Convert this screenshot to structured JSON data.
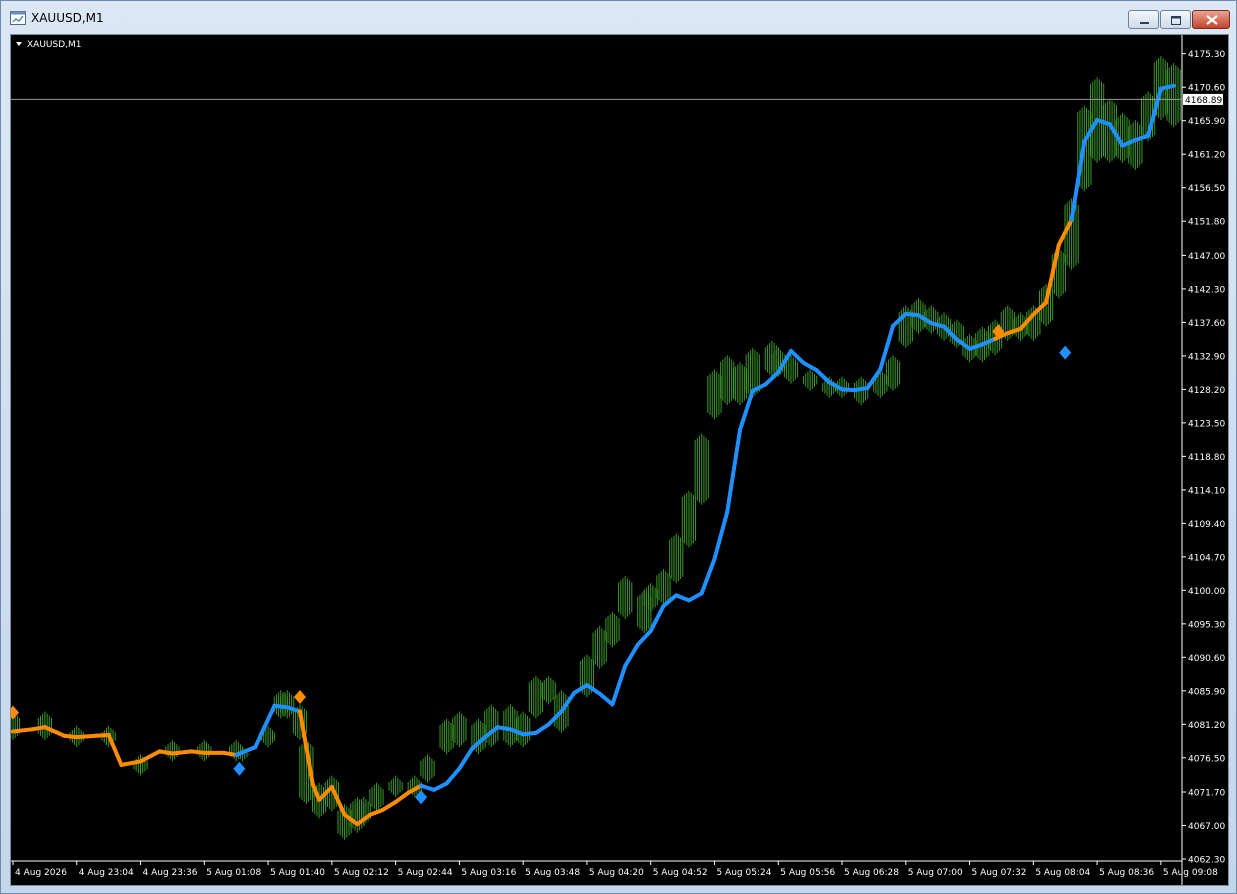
{
  "window": {
    "title": "XAUUSD,M1",
    "buttons": [
      "minimize",
      "maximize",
      "close"
    ]
  },
  "chart_header": {
    "symbol_label": "XAUUSD,M1"
  },
  "colors": {
    "background": "#000000",
    "bars": "#3c9a2a",
    "ma_up": "#1e90ff",
    "ma_down": "#ff8c00",
    "axis_text": "#ffffff"
  },
  "current_price": "4168.89",
  "chart_data": {
    "type": "line",
    "title": "",
    "ylim": [
      4062.3,
      4177.65
    ],
    "y_ticks": [
      "4175.30",
      "4170.60",
      "4165.90",
      "4161.20",
      "4156.50",
      "4151.80",
      "4147.00",
      "4142.30",
      "4137.60",
      "4132.90",
      "4128.20",
      "4123.50",
      "4118.80",
      "4114.10",
      "4109.40",
      "4104.70",
      "4100.00",
      "4095.30",
      "4090.60",
      "4085.90",
      "4081.20",
      "4076.50",
      "4071.70",
      "4067.00",
      "4062.30"
    ],
    "x_ticks": [
      "4 Aug 2026",
      "4 Aug 23:04",
      "4 Aug 23:36",
      "5 Aug 01:08",
      "5 Aug 01:40",
      "5 Aug 02:12",
      "5 Aug 02:44",
      "5 Aug 03:16",
      "5 Aug 03:48",
      "5 Aug 04:20",
      "5 Aug 04:52",
      "5 Aug 05:24",
      "5 Aug 05:56",
      "5 Aug 06:28",
      "5 Aug 07:00",
      "5 Aug 07:32",
      "5 Aug 08:04",
      "5 Aug 08:36",
      "5 Aug 09:08"
    ],
    "x_range": [
      0,
      18.3
    ],
    "grid": false,
    "series": [
      {
        "kind": "bars",
        "values_x": [
          0,
          0.5,
          1,
          1.5,
          2,
          2.5,
          3,
          3.5,
          3.6,
          4,
          4.2,
          4.3,
          4.5,
          4.6,
          4.8,
          5,
          5.2,
          5.4,
          5.5,
          5.7,
          6,
          6.3,
          6.5,
          6.8,
          7,
          7.3,
          7.5,
          7.8,
          8,
          8.2,
          8.4,
          8.6,
          9,
          9.2,
          9.4,
          9.6,
          9.9,
          10,
          10.2,
          10.4,
          10.6,
          10.8,
          11,
          11.2,
          11.4,
          11.6,
          11.9,
          12,
          12.2,
          12.5,
          12.8,
          13,
          13.3,
          13.6,
          13.8,
          14,
          14.2,
          14.4,
          14.6,
          14.8,
          15,
          15.2,
          15.4,
          15.6,
          15.8,
          16,
          16.2,
          16.4,
          16.6,
          16.8,
          17,
          17.2,
          17.4,
          17.6,
          17.8,
          18,
          18.2
        ],
        "values_y": [
          4080.6,
          4081.2,
          4079.2,
          4079.6,
          4075.8,
          4077.6,
          4077.2,
          4077.2,
          4076.9,
          4079.6,
          4083.8,
          4083.8,
          4082.9,
          4074.9,
          4070.4,
          4072.3,
          4067.5,
          4068.5,
          4069.6,
          4071.3,
          4072.7,
          4072.5,
          4074.9,
          4079.6,
          4080.6,
          4079.2,
          4081.2,
          4081.5,
          4080.3,
          4085.4,
          4086.4,
          4083.2,
          4087.0,
          4091.6,
          4094.2,
          4099.4,
          4097.0,
          4098.7,
          4100.4,
          4104.9,
          4109.5,
          4116.2,
          4128.0,
          4129.0,
          4129.4,
          4130.6,
          4133.4,
          4132.7,
          4131.7,
          4130.2,
          4128.5,
          4128.2,
          4128.3,
          4129.4,
          4130.6,
          4137.0,
          4138.5,
          4138.7,
          4137.2,
          4136.2,
          4134.0,
          4134.9,
          4135.6,
          4137.3,
          4137.5,
          4137.6,
          4140.3,
          4144.1,
          4150.4,
          4162.5,
          4166.6,
          4165.4,
          4163.2,
          4162.2,
          4168.9,
          4170.6,
          4168.9
        ],
        "values_hl": [
          [
            4079,
            4083
          ],
          [
            4079,
            4083
          ],
          [
            4078,
            4081
          ],
          [
            4078,
            4081
          ],
          [
            4074,
            4077
          ],
          [
            4076,
            4079
          ],
          [
            4076,
            4079
          ],
          [
            4076,
            4079
          ],
          [
            4076,
            4078
          ],
          [
            4078,
            4081
          ],
          [
            4082,
            4086
          ],
          [
            4082,
            4086
          ],
          [
            4079,
            4084
          ],
          [
            4070,
            4079
          ],
          [
            4068,
            4073
          ],
          [
            4069,
            4074
          ],
          [
            4065,
            4070
          ],
          [
            4066,
            4071
          ],
          [
            4067,
            4071
          ],
          [
            4069,
            4073
          ],
          [
            4071,
            4074
          ],
          [
            4071,
            4074
          ],
          [
            4073,
            4077
          ],
          [
            4077,
            4082
          ],
          [
            4078,
            4083
          ],
          [
            4077,
            4082
          ],
          [
            4078,
            4084
          ],
          [
            4078,
            4084
          ],
          [
            4078,
            4083
          ],
          [
            4082,
            4088
          ],
          [
            4084,
            4088
          ],
          [
            4080,
            4086
          ],
          [
            4085,
            4091
          ],
          [
            4089,
            4095
          ],
          [
            4092,
            4097
          ],
          [
            4096,
            4102
          ],
          [
            4094,
            4100
          ],
          [
            4097,
            4101
          ],
          [
            4098,
            4103
          ],
          [
            4101,
            4108
          ],
          [
            4106,
            4114
          ],
          [
            4112,
            4122
          ],
          [
            4124,
            4131
          ],
          [
            4126,
            4133
          ],
          [
            4126,
            4132
          ],
          [
            4127,
            4134
          ],
          [
            4130,
            4135
          ],
          [
            4130,
            4134
          ],
          [
            4129,
            4133
          ],
          [
            4128,
            4131
          ],
          [
            4127,
            4130
          ],
          [
            4127,
            4130
          ],
          [
            4126,
            4130
          ],
          [
            4127,
            4131
          ],
          [
            4128,
            4133
          ],
          [
            4134,
            4140
          ],
          [
            4136,
            4141
          ],
          [
            4136,
            4140
          ],
          [
            4135,
            4139
          ],
          [
            4134,
            4138
          ],
          [
            4132,
            4136
          ],
          [
            4132,
            4137
          ],
          [
            4133,
            4138
          ],
          [
            4135,
            4140
          ],
          [
            4135,
            4139
          ],
          [
            4135,
            4140
          ],
          [
            4137,
            4143
          ],
          [
            4141,
            4148
          ],
          [
            4145,
            4155
          ],
          [
            4156,
            4168
          ],
          [
            4160,
            4172
          ],
          [
            4160,
            4169
          ],
          [
            4160,
            4167
          ],
          [
            4159,
            4166
          ],
          [
            4163,
            4170
          ],
          [
            4166,
            4175
          ],
          [
            4165,
            4174
          ]
        ]
      },
      {
        "kind": "moving_average",
        "x": [
          0,
          0.3,
          0.5,
          0.8,
          1,
          1.3,
          1.5,
          1.7,
          2,
          2.3,
          2.5,
          2.8,
          3,
          3.3,
          3.5,
          3.8,
          3.9,
          4.1,
          4.3,
          4.5,
          4.6,
          4.7,
          4.8,
          5,
          5.2,
          5.4,
          5.6,
          5.8,
          6,
          6.2,
          6.4,
          6.6,
          6.8,
          7,
          7.2,
          7.4,
          7.6,
          7.8,
          8,
          8.2,
          8.4,
          8.6,
          8.8,
          9,
          9.2,
          9.4,
          9.6,
          9.8,
          10,
          10.2,
          10.4,
          10.6,
          10.8,
          11,
          11.2,
          11.4,
          11.6,
          11.8,
          12,
          12.2,
          12.4,
          12.6,
          12.8,
          13,
          13.2,
          13.4,
          13.6,
          13.8,
          14,
          14.2,
          14.4,
          14.6,
          14.8,
          15,
          15.2,
          15.4,
          15.6,
          15.8,
          16,
          16.2,
          16.4,
          16.6,
          16.8,
          17,
          17.2,
          17.4,
          17.6,
          17.8,
          18,
          18.2
        ],
        "y": [
          4080.2,
          4080.5,
          4080.8,
          4079.6,
          4079.4,
          4079.6,
          4079.7,
          4075.5,
          4076.0,
          4077.4,
          4077.1,
          4077.4,
          4077.2,
          4077.2,
          4076.9,
          4078.0,
          4080.0,
          4083.8,
          4083.6,
          4083.0,
          4078.0,
          4072.8,
          4070.6,
          4072.4,
          4068.5,
          4067.2,
          4068.5,
          4069.2,
          4070.3,
          4071.6,
          4072.6,
          4072.0,
          4072.9,
          4075.0,
          4077.8,
          4079.4,
          4080.8,
          4080.5,
          4079.8,
          4080.0,
          4081.2,
          4083.0,
          4085.6,
          4086.7,
          4085.5,
          4084.0,
          4089.4,
          4092.4,
          4094.3,
          4097.8,
          4099.3,
          4098.6,
          4099.6,
          4104.4,
          4111.0,
          4122.5,
          4128.0,
          4128.9,
          4130.6,
          4133.6,
          4131.9,
          4130.9,
          4129.2,
          4128.2,
          4128.1,
          4128.4,
          4131.0,
          4137.1,
          4138.8,
          4138.6,
          4137.5,
          4137.0,
          4135.2,
          4133.9,
          4134.5,
          4135.3,
          4136.1,
          4136.7,
          4138.7,
          4140.4,
          4148.5,
          4152.0,
          4163.0,
          4166.0,
          4165.4,
          4162.4,
          4163.2,
          4163.8,
          4170.4,
          4170.8
        ]
      }
    ],
    "markers": [
      {
        "x": 0.0,
        "y": 4082.0,
        "color": "#ff8c00",
        "kind": "sell"
      },
      {
        "x": 3.55,
        "y": 4075.8,
        "color": "#1e90ff",
        "kind": "buy"
      },
      {
        "x": 4.5,
        "y": 4084.2,
        "color": "#ff8c00",
        "kind": "sell"
      },
      {
        "x": 6.4,
        "y": 4071.8,
        "color": "#1e90ff",
        "kind": "buy"
      },
      {
        "x": 15.45,
        "y": 4135.5,
        "color": "#ff8c00",
        "kind": "sell"
      },
      {
        "x": 16.5,
        "y": 4134.2,
        "color": "#1e90ff",
        "kind": "buy"
      }
    ],
    "ma_color_segments": [
      {
        "from": 0,
        "to": 3.55,
        "color": "#ff8c00"
      },
      {
        "from": 3.55,
        "to": 4.5,
        "color": "#1e90ff"
      },
      {
        "from": 4.5,
        "to": 6.4,
        "color": "#ff8c00"
      },
      {
        "from": 6.4,
        "to": 15.45,
        "color": "#1e90ff"
      },
      {
        "from": 15.45,
        "to": 16.5,
        "color": "#ff8c00"
      },
      {
        "from": 16.5,
        "to": 18.2,
        "color": "#1e90ff"
      }
    ],
    "current_price_line": 4168.89
  }
}
